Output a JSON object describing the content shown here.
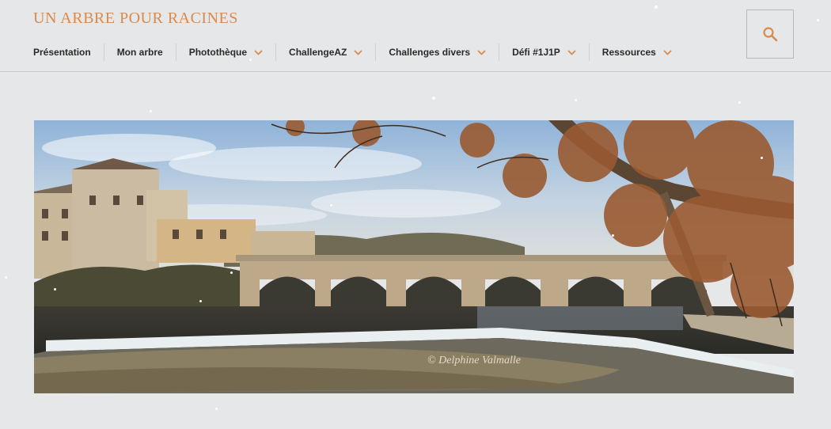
{
  "site": {
    "title": "UN ARBRE POUR RACINES"
  },
  "nav": {
    "items": [
      {
        "label": "Présentation",
        "dropdown": false
      },
      {
        "label": "Mon arbre",
        "dropdown": false
      },
      {
        "label": "Photothèque",
        "dropdown": true
      },
      {
        "label": "ChallengeAZ",
        "dropdown": true
      },
      {
        "label": "Challenges divers",
        "dropdown": true
      },
      {
        "label": "Défi #1J1P",
        "dropdown": true
      },
      {
        "label": "Ressources",
        "dropdown": true
      }
    ]
  },
  "search": {
    "icon": "search-icon"
  },
  "banner": {
    "watermark": "© Delphine Valmalle",
    "alt": ""
  },
  "colors": {
    "accent": "#d98a4e",
    "background": "#e6e7e8",
    "nav_text": "#2a2a2a"
  }
}
